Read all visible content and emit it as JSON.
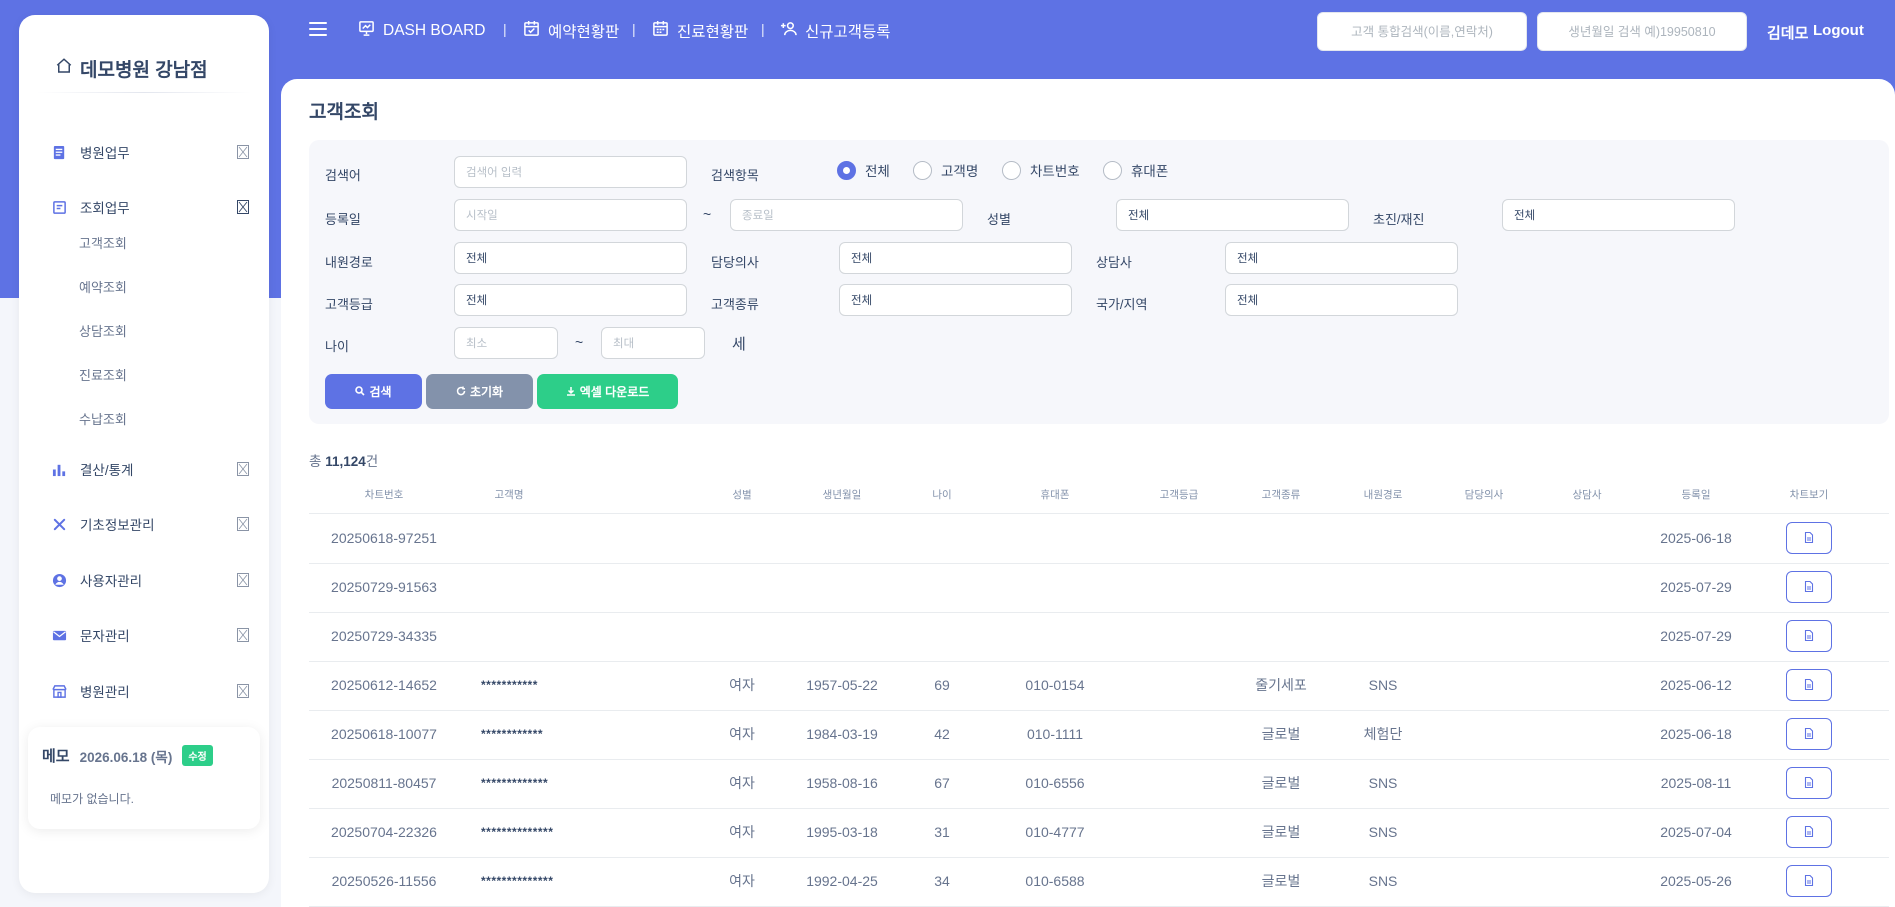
{
  "sidebar": {
    "brand": "데모병원 강남점",
    "menu": [
      {
        "label": "병원업무",
        "icon": "document-icon"
      },
      {
        "label": "조회업무",
        "icon": "form-icon"
      },
      {
        "label": "결산/통계",
        "icon": "bar-chart-icon"
      },
      {
        "label": "기초정보관리",
        "icon": "tools-icon"
      },
      {
        "label": "사용자관리",
        "icon": "user-circle-icon"
      },
      {
        "label": "문자관리",
        "icon": "envelope-icon"
      },
      {
        "label": "병원관리",
        "icon": "building-icon"
      }
    ],
    "submenu": [
      "고객조회",
      "예약조회",
      "상담조회",
      "진료조회",
      "수납조회"
    ],
    "memo": {
      "title": "메모",
      "date": "2026.06.18 (목)",
      "edit_label": "수정",
      "empty_text": "메모가 없습니다."
    }
  },
  "topnav": {
    "links": [
      {
        "label": "DASH BOARD",
        "icon": "presentation-icon"
      },
      {
        "label": "예약현황판",
        "icon": "calendar-check-icon"
      },
      {
        "label": "진료현황판",
        "icon": "calendar-icon"
      },
      {
        "label": "신규고객등록",
        "icon": "user-plus-icon"
      }
    ],
    "search_placeholder": "고객 통합검색(이름,연락처)",
    "birth_placeholder": "생년월일 검색 예)19950810",
    "user_name": "김데모",
    "logout_label": "Logout"
  },
  "page": {
    "title": "고객조회",
    "form": {
      "keyword_label": "검색어",
      "keyword_placeholder": "검색어 입력",
      "search_field_label": "검색항목",
      "radio_options": [
        "전체",
        "고객명",
        "차트번호",
        "휴대폰"
      ],
      "radio_selected": "전체",
      "reg_date_label": "등록일",
      "start_placeholder": "시작일",
      "end_placeholder": "종료일",
      "tilde": "~",
      "gender_label": "성별",
      "gender_value": "전체",
      "visit_type_label": "초진/재진",
      "visit_type_value": "전체",
      "route_label": "내원경로",
      "route_value": "전체",
      "doctor_label": "담당의사",
      "doctor_value": "전체",
      "counselor_label": "상담사",
      "counselor_value": "전체",
      "grade_label": "고객등급",
      "grade_value": "전체",
      "kind_label": "고객종류",
      "kind_value": "전체",
      "country_label": "국가/지역",
      "country_value": "전체",
      "age_label": "나이",
      "age_min_placeholder": "최소",
      "age_max_placeholder": "최대",
      "age_unit": "세",
      "search_btn": "검색",
      "reset_btn": "초기화",
      "excel_btn": "엑셀 다운로드"
    },
    "total_prefix": "총",
    "total_count": "11,124",
    "total_suffix": "건"
  },
  "colors": {
    "primary": "#5e72e4",
    "secondary": "#8392ab",
    "success": "#2dce89"
  },
  "table": {
    "columns": [
      "차트번호",
      "고객명",
      "성별",
      "생년월일",
      "나이",
      "휴대폰",
      "고객등급",
      "고객종류",
      "내원경로",
      "담당의사",
      "상담사",
      "등록일",
      "차트보기"
    ],
    "rows": [
      [
        "20250618-97251",
        "",
        "",
        "",
        "",
        "",
        "",
        "",
        "",
        "",
        "",
        "2025-06-18"
      ],
      [
        "20250729-91563",
        "",
        "",
        "",
        "",
        "",
        "",
        "",
        "",
        "",
        "",
        "2025-07-29"
      ],
      [
        "20250729-34335",
        "",
        "",
        "",
        "",
        "",
        "",
        "",
        "",
        "",
        "",
        "2025-07-29"
      ],
      [
        "20250612-14652",
        "***********",
        "여자",
        "1957-05-22",
        "69",
        "010-0154",
        "",
        "줄기세포",
        "SNS",
        "",
        "",
        "2025-06-12"
      ],
      [
        "20250618-10077",
        "************",
        "여자",
        "1984-03-19",
        "42",
        "010-1111",
        "",
        "글로벌",
        "체험단",
        "",
        "",
        "2025-06-18"
      ],
      [
        "20250811-80457",
        "*************",
        "여자",
        "1958-08-16",
        "67",
        "010-6556",
        "",
        "글로벌",
        "SNS",
        "",
        "",
        "2025-08-11"
      ],
      [
        "20250704-22326",
        "**************",
        "여자",
        "1995-03-18",
        "31",
        "010-4777",
        "",
        "글로벌",
        "SNS",
        "",
        "",
        "2025-07-04"
      ],
      [
        "20250526-11556",
        "**************",
        "여자",
        "1992-04-25",
        "34",
        "010-6588",
        "",
        "글로벌",
        "SNS",
        "",
        "",
        "2025-05-26"
      ]
    ]
  }
}
